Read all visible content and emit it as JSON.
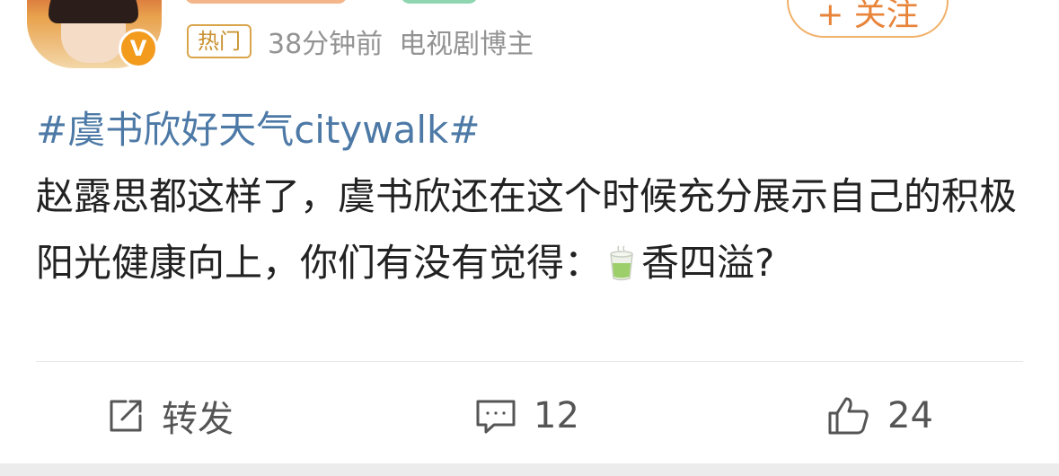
{
  "header": {
    "hot_tag": "热门",
    "time_ago": "38分钟前",
    "user_type": "电视剧博主",
    "follow_label": "+ 关注",
    "verified_mark": "V"
  },
  "post": {
    "topic": "#虞书欣好天气citywalk#",
    "text_before_emoji": "赵露思都这样了，虞书欣还在这个时候充分展示自己的积极阳光健康向上，你们有没有觉得：",
    "emoji": "tea-cup-icon",
    "text_after_emoji": "香四溢?"
  },
  "actions": {
    "repost_label": "转发",
    "comment_count": "12",
    "like_count": "24"
  },
  "colors": {
    "topic_link": "#4d79a6",
    "hot_tag": "#c8902e",
    "follow": "#e8843a",
    "meta_text": "#939393"
  }
}
